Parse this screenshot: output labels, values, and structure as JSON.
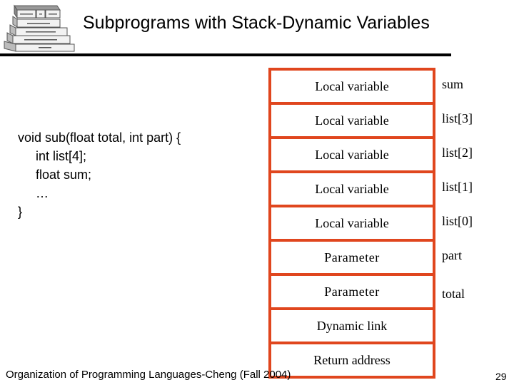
{
  "slide": {
    "title": "Subprograms with Stack-Dynamic Variables",
    "logo_icon": "language-hierarchy-pyramid-icon",
    "code_lines": [
      "void sub(float total, int part) {",
      "int list[4];",
      "float sum;",
      "…",
      "}"
    ],
    "stack_frame": [
      {
        "cell": "Local variable",
        "label": "sum"
      },
      {
        "cell": "Local variable",
        "label": "list[3]"
      },
      {
        "cell": "Local variable",
        "label": "list[2]"
      },
      {
        "cell": "Local variable",
        "label": "list[1]"
      },
      {
        "cell": "Local variable",
        "label": "list[0]"
      },
      {
        "cell": "Parameter",
        "label": "part"
      },
      {
        "cell": "Parameter",
        "label": "total"
      },
      {
        "cell": "Dynamic link",
        "label": ""
      },
      {
        "cell": "Return address",
        "label": ""
      }
    ],
    "stack_border_color": "#e0461e",
    "footer": "Organization of Programming Languages-Cheng (Fall 2004)",
    "page_number": "29"
  }
}
